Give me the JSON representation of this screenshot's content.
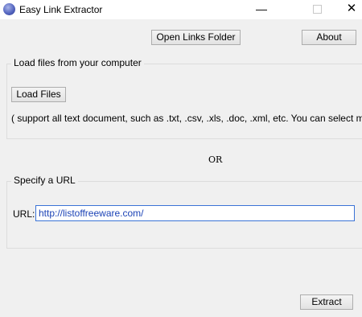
{
  "window": {
    "title": "Easy Link Extractor",
    "icon": "globe-icon",
    "controls": {
      "minimize": "—",
      "close": "✕"
    }
  },
  "toolbar": {
    "open_folder_label": "Open Links Folder",
    "about_label": "About"
  },
  "load_group": {
    "legend": "Load files from your computer",
    "load_button_label": "Load Files",
    "support_note": "( support all text document, such as .txt, .csv, .xls, .doc, .xml, etc. You can select m"
  },
  "separator": {
    "or_label": "OR"
  },
  "url_group": {
    "legend": "Specify a URL",
    "url_label": "URL:",
    "url_value": "http://listoffreeware.com/"
  },
  "footer": {
    "extract_label": "Extract"
  },
  "colors": {
    "accent_border": "#3b73d6",
    "url_text": "#1c43b6"
  }
}
